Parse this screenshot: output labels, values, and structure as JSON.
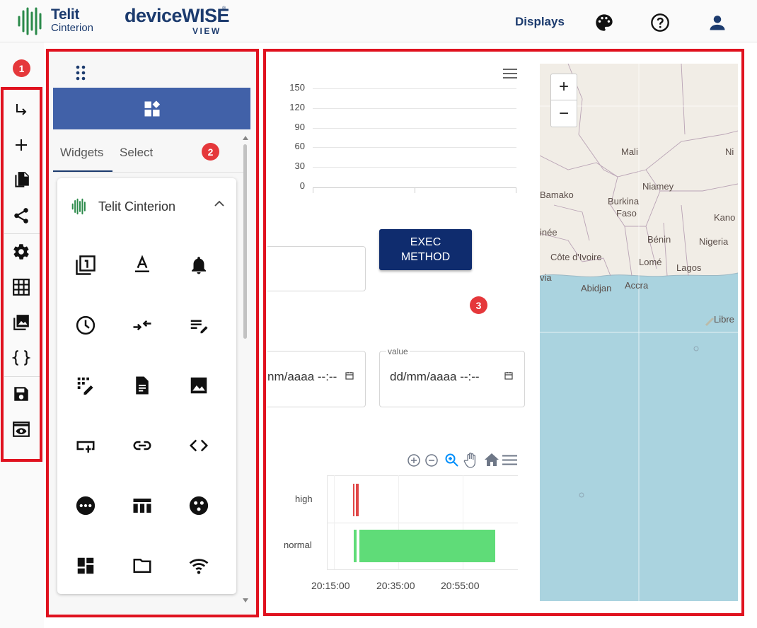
{
  "header": {
    "brand_line1": "Telit",
    "brand_line2": "Cinterion",
    "product_name": "deviceWISE",
    "product_reg": "®",
    "product_sub": "VIEW",
    "nav_displays": "Displays",
    "icons": [
      "palette-icon",
      "help-icon",
      "account-icon"
    ]
  },
  "toolbar": {
    "items": [
      "subdirectory-arrow-icon",
      "add-icon",
      "copy-icon",
      "share-icon",
      "settings-icon",
      "grid-icon",
      "image-icon",
      "code-braces-icon",
      "save-icon",
      "preview-icon"
    ]
  },
  "callouts": [
    "1",
    "2",
    "3"
  ],
  "panel": {
    "tabs": [
      "Widgets",
      "Select"
    ],
    "group_title": "Telit Cinterion",
    "widget_icons": [
      "counter-icon",
      "text-format-icon",
      "bell-icon",
      "clock-icon",
      "compare-arrows-icon",
      "edit-note-icon",
      "dialpad-edit-icon",
      "document-icon",
      "image-icon",
      "input-icon",
      "link-icon",
      "code-icon",
      "more-circle-icon",
      "table-icon",
      "scatter-dots-icon",
      "dashboard-icon",
      "folder-icon",
      "wifi-icon"
    ]
  },
  "canvas": {
    "chart": {
      "y_ticks": [
        "150",
        "120",
        "90",
        "60",
        "30",
        "0"
      ]
    },
    "exec_button": "EXEC\nMETHOD",
    "date_field_1": {
      "value": "nm/aaaa --:--"
    },
    "date_field_2": {
      "label": "value",
      "value": "dd/mm/aaaa --:--"
    },
    "timeline": {
      "categories": [
        "high",
        "normal"
      ],
      "x_ticks": [
        "20:15:00",
        "20:35:00",
        "20:55:00"
      ],
      "tools": [
        "zoom-in-icon",
        "zoom-out-icon",
        "zoom-select-icon",
        "pan-icon",
        "home-icon",
        "menu-icon"
      ]
    },
    "map": {
      "zoom_in": "+",
      "zoom_out": "−",
      "places": [
        "Mali",
        "Ni",
        "Niamey",
        "Bamako",
        "Burkina",
        "Faso",
        "Kano",
        "inée",
        "Bénin",
        "Nigeria",
        "Côte d'Ivoire",
        "Lomé",
        "Lagos",
        "via",
        "Abidjan",
        "Accra",
        "Libre"
      ]
    }
  },
  "colors": {
    "brand": "#1c3b6e",
    "panel_head": "#4161a8",
    "callout": "#e0121f",
    "bar_green": "#5fdc78",
    "bar_red": "#e04646",
    "sea": "#aad3df"
  }
}
